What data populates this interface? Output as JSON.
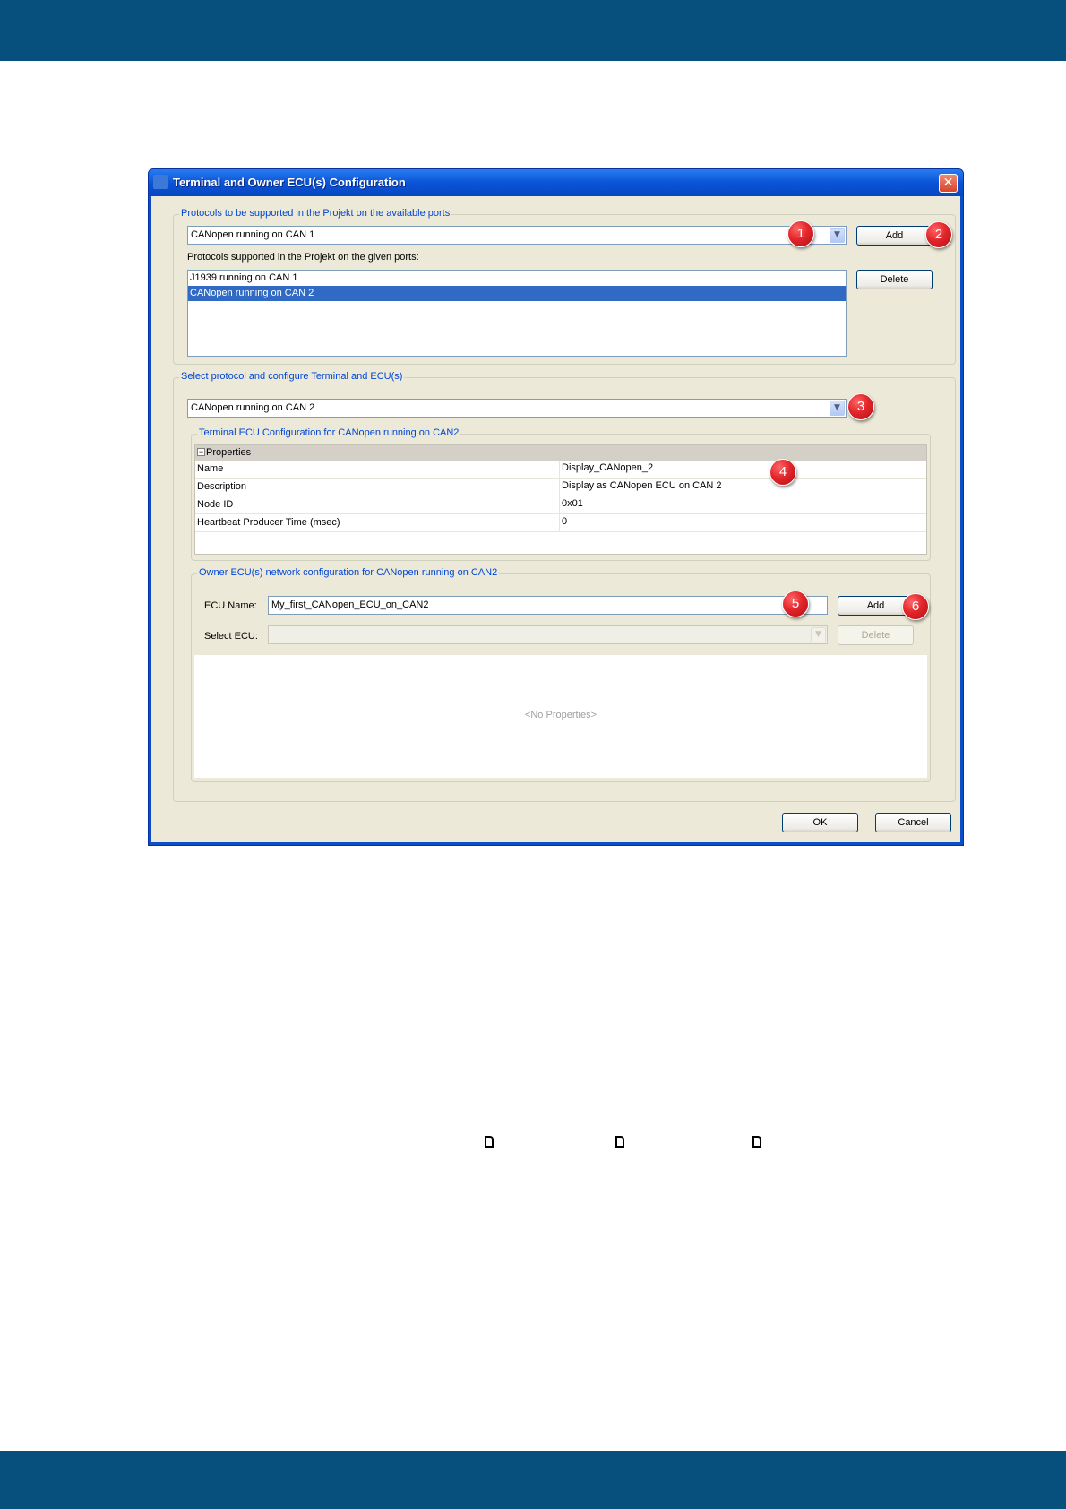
{
  "dialog": {
    "title": "Terminal and Owner ECU(s) Configuration",
    "close_glyph": "✕",
    "protocols_group": {
      "legend": "Protocols to be supported in the Projekt on the available ports",
      "protocol_select": "CANopen running on CAN 1",
      "add_label": "Add",
      "supported_label": "Protocols supported in the Projekt on the given ports:",
      "supported_items": [
        "J1939 running on CAN 1",
        "CANopen running on CAN 2"
      ],
      "selected_index": 1,
      "delete_label": "Delete"
    },
    "select_group": {
      "legend": "Select protocol and configure Terminal and ECU(s)",
      "protocol_select": "CANopen running on CAN 2",
      "terminal_group": {
        "legend": "Terminal ECU Configuration for CANopen running on CAN2",
        "category": "Properties",
        "toggle": "−",
        "rows": [
          {
            "key": "Name",
            "value": "Display_CANopen_2"
          },
          {
            "key": "Description",
            "value": "Display as CANopen ECU on CAN 2"
          },
          {
            "key": "Node ID",
            "value": "0x01"
          },
          {
            "key": "Heartbeat Producer Time (msec)",
            "value": "0"
          }
        ]
      },
      "owner_group": {
        "legend": "Owner ECU(s) network configuration  for CANopen running on CAN2",
        "ecu_name_label": "ECU Name:",
        "ecu_name_value": "My_first_CANopen_ECU_on_CAN2",
        "add_label": "Add",
        "select_ecu_label": "Select ECU:",
        "select_ecu_value": "",
        "delete_label": "Delete",
        "no_properties": "<No Properties>"
      }
    },
    "ok_label": "OK",
    "cancel_label": "Cancel"
  },
  "markers": [
    "1",
    "2",
    "3",
    "4",
    "5",
    "6"
  ],
  "colors": {
    "page_band": "#074f7c",
    "legend_text": "#0046d5",
    "selection": "#316ac5",
    "marker": "#e2262b"
  }
}
